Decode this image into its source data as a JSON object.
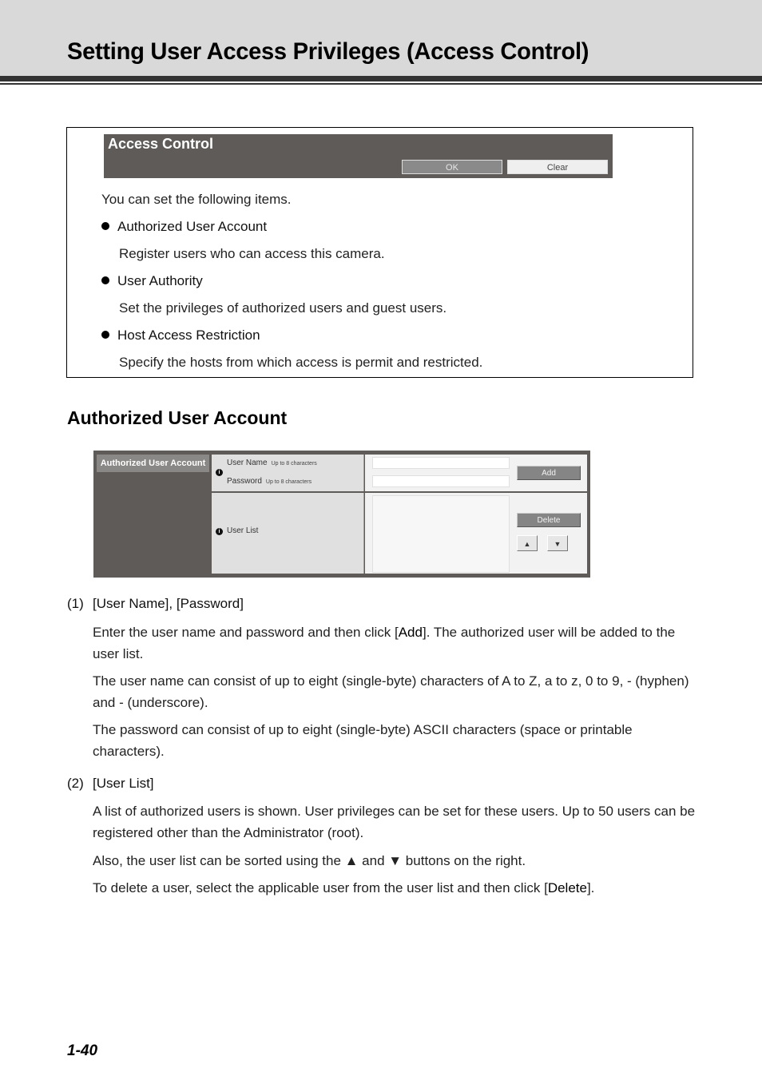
{
  "page": {
    "title": "Setting User Access Privileges (Access Control)",
    "page_number": "1-40"
  },
  "access_control_panel": {
    "title": "Access Control",
    "ok_label": "OK",
    "clear_label": "Clear"
  },
  "intro": {
    "lead": "You can set the following items.",
    "items": [
      {
        "label": "Authorized User Account",
        "desc": "Register users who can access this camera."
      },
      {
        "label": "User Authority",
        "desc": "Set the privileges of authorized users and guest users."
      },
      {
        "label": "Host Access Restriction",
        "desc": "Specify the hosts from which access is permit and restricted."
      }
    ]
  },
  "section": {
    "heading": "Authorized User Account"
  },
  "user_account_panel": {
    "label": "Authorized User Account",
    "user_name_label": "User Name",
    "user_name_hint": "Up to 8 characters",
    "password_label": "Password",
    "password_hint": "Up to 8 characters",
    "user_name_value": "",
    "password_value": "",
    "user_list_label": "User List",
    "add_label": "Add",
    "delete_label": "Delete",
    "up_label": "▲",
    "down_label": "▼",
    "info_glyph": "i"
  },
  "items": [
    {
      "number": "(1)",
      "heading": "[User Name], [Password]",
      "paragraphs": [
        {
          "pre": "Enter the user name and password and then click [",
          "bold": "Add",
          "post": "]. The authorized user will be added to the user list."
        },
        {
          "text": "The user name can consist of up to eight (single-byte) characters of A to Z, a to z, 0 to 9, - (hyphen) and - (underscore)."
        },
        {
          "text": "The password can consist of up to eight (single-byte) ASCII characters (space or printable characters)."
        }
      ]
    },
    {
      "number": "(2)",
      "heading": "[User List]",
      "paragraphs": [
        {
          "text": "A list of authorized users is shown. User privileges can be set for these users. Up to 50 users can be registered other than the Administrator (root)."
        },
        {
          "text": "Also, the user list can be sorted using the ▲ and ▼ buttons on the right."
        },
        {
          "pre": "To delete a user, select the applicable user from the user list and then click [",
          "bold": "Delete",
          "post": "]."
        }
      ]
    }
  ]
}
